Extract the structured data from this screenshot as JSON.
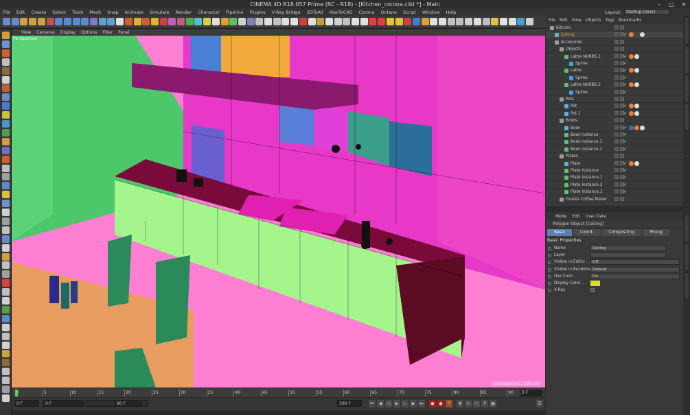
{
  "window": {
    "title": "CINEMA 4D R18.057 Prime (RC - R18) - [Kitchen_corona.c4d *] - Main"
  },
  "menu": [
    "File",
    "Edit",
    "Create",
    "Select",
    "Tools",
    "Mesh",
    "Snap",
    "Animate",
    "Simulate",
    "Render",
    "Character",
    "Pipeline",
    "Plugins",
    "V-Ray Bridge",
    "3DToAll",
    "MaxToC4D",
    "Corona",
    "Octane",
    "Script",
    "Window",
    "Help"
  ],
  "layout": {
    "label": "Layout:",
    "value": "Startup (User)"
  },
  "viewport_menu": [
    "View",
    "Cameras",
    "Display",
    "Options",
    "Filter",
    "Panel"
  ],
  "viewport": {
    "name": "Perspective",
    "grid_spacing": "Grid Spacing : 100 cm"
  },
  "timeline": {
    "ticks": [
      "0",
      "5",
      "10",
      "15",
      "20",
      "25",
      "30",
      "35",
      "40",
      "45",
      "50",
      "55",
      "60",
      "65",
      "70",
      "75",
      "80",
      "85",
      "90"
    ],
    "current_frame": "0 F"
  },
  "transport": {
    "start": "0 F",
    "min": "0 F",
    "max": "90 F",
    "end": "300 F"
  },
  "object_manager": {
    "menu": [
      "File",
      "Edit",
      "View",
      "Objects",
      "Tags",
      "Bookmarks"
    ],
    "rows": [
      {
        "name": "Kitchen",
        "indent": 0,
        "kind": "null",
        "tags": []
      },
      {
        "name": "Ceiling",
        "indent": 1,
        "kind": "poly",
        "tags": [
          "#f08030",
          "#444",
          "#ddd"
        ],
        "hl": true
      },
      {
        "name": "Accesories",
        "indent": 1,
        "kind": "null",
        "tags": []
      },
      {
        "name": "Objects",
        "indent": 2,
        "kind": "null",
        "tags": []
      },
      {
        "name": "Lathe NURBS.1",
        "indent": 3,
        "kind": "gen",
        "tags": [
          "#f08030",
          "#ddd"
        ]
      },
      {
        "name": "Spline",
        "indent": 4,
        "kind": "spline",
        "tags": []
      },
      {
        "name": "Lathe",
        "indent": 3,
        "kind": "gen",
        "tags": [
          "#f08030",
          "#ddd"
        ]
      },
      {
        "name": "Spline",
        "indent": 4,
        "kind": "spline",
        "tags": []
      },
      {
        "name": "Lathe NURBS.2",
        "indent": 3,
        "kind": "gen",
        "tags": [
          "#f08030",
          "#ddd"
        ]
      },
      {
        "name": "Spline",
        "indent": 4,
        "kind": "spline",
        "tags": []
      },
      {
        "name": "Pots",
        "indent": 2,
        "kind": "null",
        "tags": []
      },
      {
        "name": "Pot",
        "indent": 3,
        "kind": "poly",
        "tags": [
          "#f08030",
          "#ddd"
        ]
      },
      {
        "name": "Pot.1",
        "indent": 3,
        "kind": "poly",
        "tags": [
          "#f08030",
          "#ddd"
        ]
      },
      {
        "name": "Bowls",
        "indent": 2,
        "kind": "null",
        "tags": []
      },
      {
        "name": "Bowl",
        "indent": 3,
        "kind": "poly",
        "tags": [
          "#3a6fb8",
          "#f08030",
          "#ddd"
        ]
      },
      {
        "name": "Bowl Instance",
        "indent": 3,
        "kind": "inst",
        "tags": []
      },
      {
        "name": "Bowl Instance.1",
        "indent": 3,
        "kind": "inst",
        "tags": []
      },
      {
        "name": "Bowl Instance.2",
        "indent": 3,
        "kind": "inst",
        "tags": []
      },
      {
        "name": "Plates",
        "indent": 2,
        "kind": "null",
        "tags": []
      },
      {
        "name": "Plate",
        "indent": 3,
        "kind": "poly",
        "tags": [
          "#f08030",
          "#ddd"
        ]
      },
      {
        "name": "Plate Instance",
        "indent": 3,
        "kind": "inst",
        "tags": []
      },
      {
        "name": "Plate Instance.1",
        "indent": 3,
        "kind": "inst",
        "tags": []
      },
      {
        "name": "Plate Instance.2",
        "indent": 3,
        "kind": "inst",
        "tags": []
      },
      {
        "name": "Plate Instance.3",
        "indent": 3,
        "kind": "inst",
        "tags": []
      },
      {
        "name": "Gustos Coffee Maker",
        "indent": 2,
        "kind": "null",
        "tags": []
      }
    ]
  },
  "attributes": {
    "menu": [
      "Mode",
      "Edit",
      "User Data"
    ],
    "title": "Polygon Object [Ceiling]",
    "tabs": [
      "Basic",
      "Coord.",
      "Compositing",
      "Phong"
    ],
    "section": "Basic Properties",
    "props": [
      {
        "label": "Name",
        "value": "Ceiling"
      },
      {
        "label": "Layer",
        "value": ""
      },
      {
        "label": "Visible in Editor . . .",
        "value": "Off"
      },
      {
        "label": "Visible in Renderer",
        "value": "Default"
      },
      {
        "label": "Use Color",
        "value": "On"
      },
      {
        "label": "Display Color. . .",
        "value": "",
        "color": "#d8e018"
      },
      {
        "label": "X-Ray",
        "value": "",
        "check": true
      }
    ]
  },
  "colors": {
    "viewport_floor": "#ff7fd3",
    "wall_green": "#4cc86a",
    "wall_magenta": "#e838c8",
    "cabinet": "#a4f58c",
    "counter": "#7a0a3a",
    "hood": "#8b1a6e",
    "cabinet_orange": "#f2a83a"
  }
}
